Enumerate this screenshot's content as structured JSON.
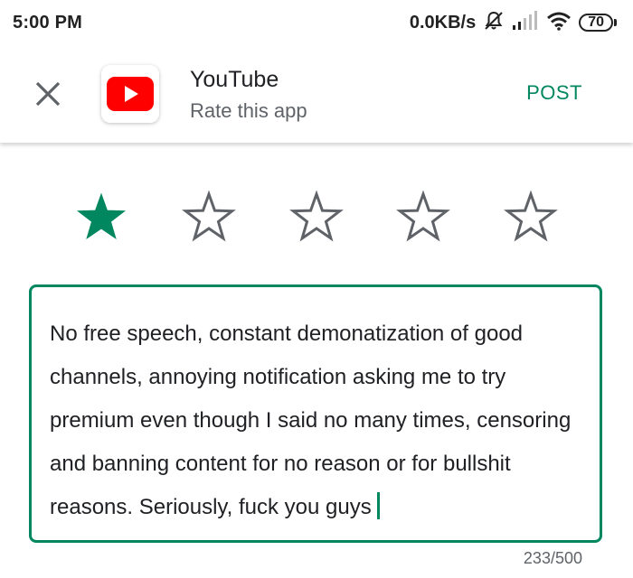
{
  "status_bar": {
    "time": "5:00 PM",
    "net_speed": "0.0KB/s",
    "battery_level": "70",
    "icons": [
      "alarm-off-icon",
      "signal-icon",
      "wifi-icon",
      "battery-icon"
    ]
  },
  "header": {
    "close_icon": "close-icon",
    "app_name": "YouTube",
    "subtitle": "Rate this app",
    "post_label": "POST",
    "accent_color": "#01875f"
  },
  "rating": {
    "max": 5,
    "value": 1,
    "filled_color": "#01875f",
    "empty_color": "#5f6368"
  },
  "review": {
    "text": "No free speech, constant demonatization of good channels, annoying notification asking me to try premium even though I said no many times, censoring and banning content for no reason or for bullshit reasons. Seriously, fuck you guys",
    "char_count": "233/500"
  }
}
